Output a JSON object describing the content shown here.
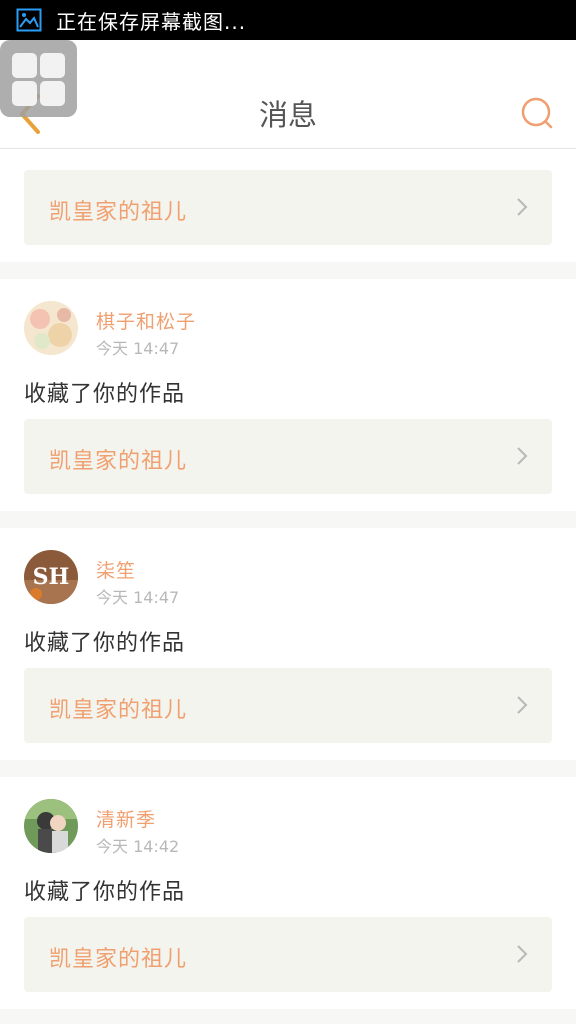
{
  "status_bar": {
    "text": "正在保存屏幕截图..."
  },
  "header": {
    "title": "消息"
  },
  "partial_card": {
    "work_title": "凯皇家的祖儿"
  },
  "messages": [
    {
      "username": "棋子和松子",
      "time": "今天 14:47",
      "action": "收藏了你的作品",
      "work_title": "凯皇家的祖儿"
    },
    {
      "username": "柒笙",
      "time": "今天 14:47",
      "action": "收藏了你的作品",
      "work_title": "凯皇家的祖儿"
    },
    {
      "username": "清新季",
      "time": "今天 14:42",
      "action": "收藏了你的作品",
      "work_title": "凯皇家的祖儿"
    }
  ],
  "colors": {
    "accent": "#f0a070",
    "work_box_bg": "#f4f4ee",
    "separator": "#f7f7f5"
  }
}
